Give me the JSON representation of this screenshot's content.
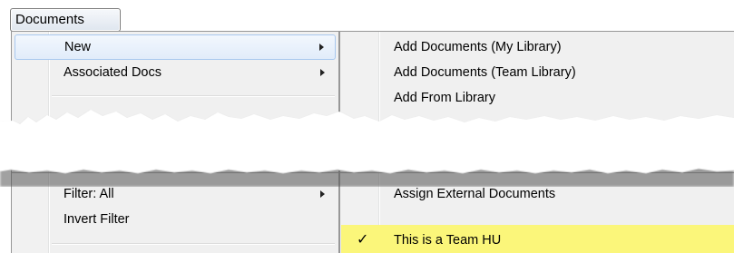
{
  "menubar": {
    "documents_label": "Documents"
  },
  "left_menu": {
    "items": [
      {
        "label": "New",
        "has_submenu": true,
        "highlighted": true
      },
      {
        "label": "Associated Docs",
        "has_submenu": true
      }
    ],
    "items_after_tear": [
      {
        "label": "Filter: All",
        "has_submenu": true
      },
      {
        "label": "Invert Filter",
        "has_submenu": false
      }
    ]
  },
  "right_menu": {
    "items": [
      {
        "label": "Add Documents (My Library)"
      },
      {
        "label": "Add Documents (Team Library)"
      },
      {
        "label": "Add From Library",
        "partially_visible": true,
        "visible_fragment": "A…From Li…"
      }
    ],
    "items_after_tear": [
      {
        "label": "Assign External Documents"
      },
      {
        "label": "This is a Team HU",
        "checked": true,
        "highlight_color": "#fbf67a"
      }
    ]
  },
  "colors": {
    "menu_background": "#f0f0f0",
    "highlight_border": "#a8c8ef",
    "highlight_fill": "#e1ecfa",
    "check_highlight": "#fbf67a"
  },
  "icons": {
    "submenu_arrow": "chevron-right-icon",
    "checkmark": "checkmark-icon"
  }
}
